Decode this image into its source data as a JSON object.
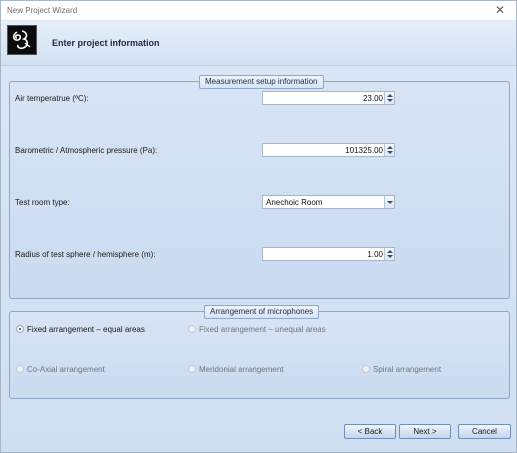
{
  "window": {
    "title": "New Project Wizard",
    "close_glyph": "✕"
  },
  "header": {
    "title": "Enter project information",
    "logo_icon": "app-logo-icon"
  },
  "measurement": {
    "legend": "Measurement setup information",
    "air_temp": {
      "label": "Air temperatrue (ºC):",
      "value": "23.00"
    },
    "pressure": {
      "label": "Barometric / Atmospheric pressure (Pa):",
      "value": "101325.00"
    },
    "room_type": {
      "label": "Test room type:",
      "value": "Anechoic Room"
    },
    "radius": {
      "label": "Radius of test sphere / hemisphere (m):",
      "value": "1.00"
    }
  },
  "arrangement": {
    "legend": "Arrangement of microphones",
    "options": [
      {
        "label": "Fixed arrangement – equal areas",
        "checked": true,
        "enabled": true
      },
      {
        "label": "Fixed arrangement – unequal areas",
        "checked": false,
        "enabled": false
      },
      {
        "label": "Co-Axial arrangement",
        "checked": false,
        "enabled": false
      },
      {
        "label": "Meridonial arrangement",
        "checked": false,
        "enabled": false
      },
      {
        "label": "Spiral arrangement",
        "checked": false,
        "enabled": false
      }
    ]
  },
  "buttons": {
    "back": "< Back",
    "next": "Next >",
    "cancel": "Cancel"
  }
}
